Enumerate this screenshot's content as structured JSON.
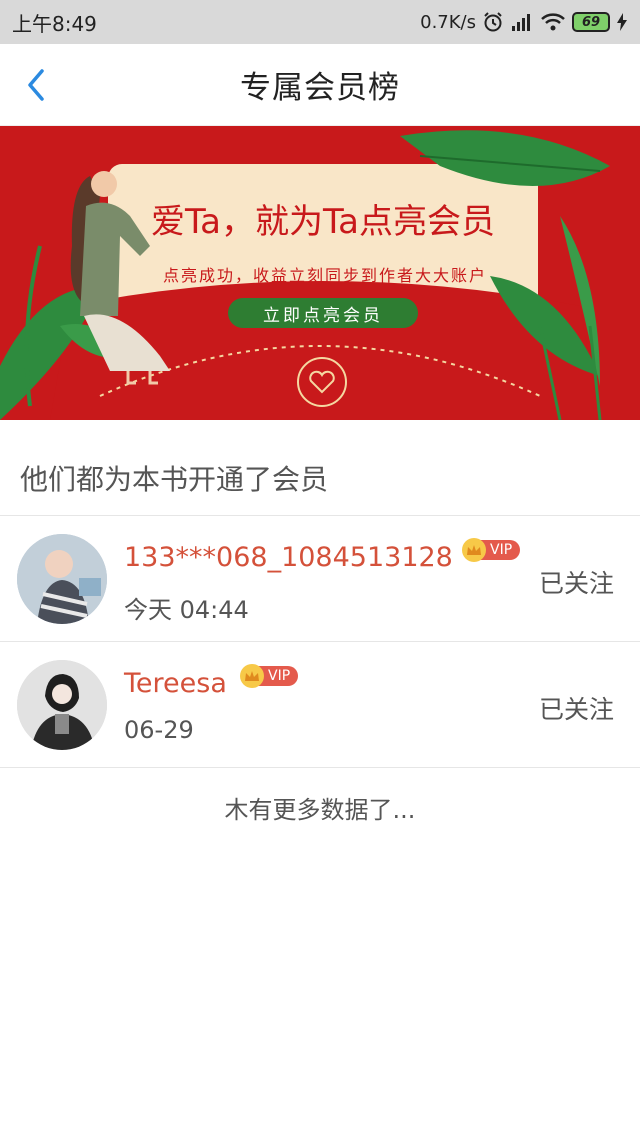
{
  "status_bar": {
    "time": "上午8:49",
    "network_speed": "0.7K/s",
    "battery_level": "69",
    "icons": [
      "alarm-icon",
      "signal-icon",
      "wifi-icon",
      "battery-icon",
      "charging-icon"
    ]
  },
  "header": {
    "title": "专属会员榜",
    "back_icon": "chevron-left-icon",
    "accent_color": "#2b8ae0"
  },
  "banner": {
    "headline": "爱Ta，就为Ta点亮会员",
    "subtext": "点亮成功，收益立刻同步到作者大大账户",
    "cta_label": "立即点亮会员",
    "background_color": "#c8191b"
  },
  "section": {
    "title": "他们都为本书开通了会员"
  },
  "members": [
    {
      "name": "133***068_1084513128",
      "badge": "VIP",
      "time": "今天 04:44",
      "follow_status": "已关注"
    },
    {
      "name": "Tereesa",
      "badge": "VIP",
      "time": "06-29",
      "follow_status": "已关注"
    }
  ],
  "footer": {
    "no_more_text": "木有更多数据了..."
  }
}
